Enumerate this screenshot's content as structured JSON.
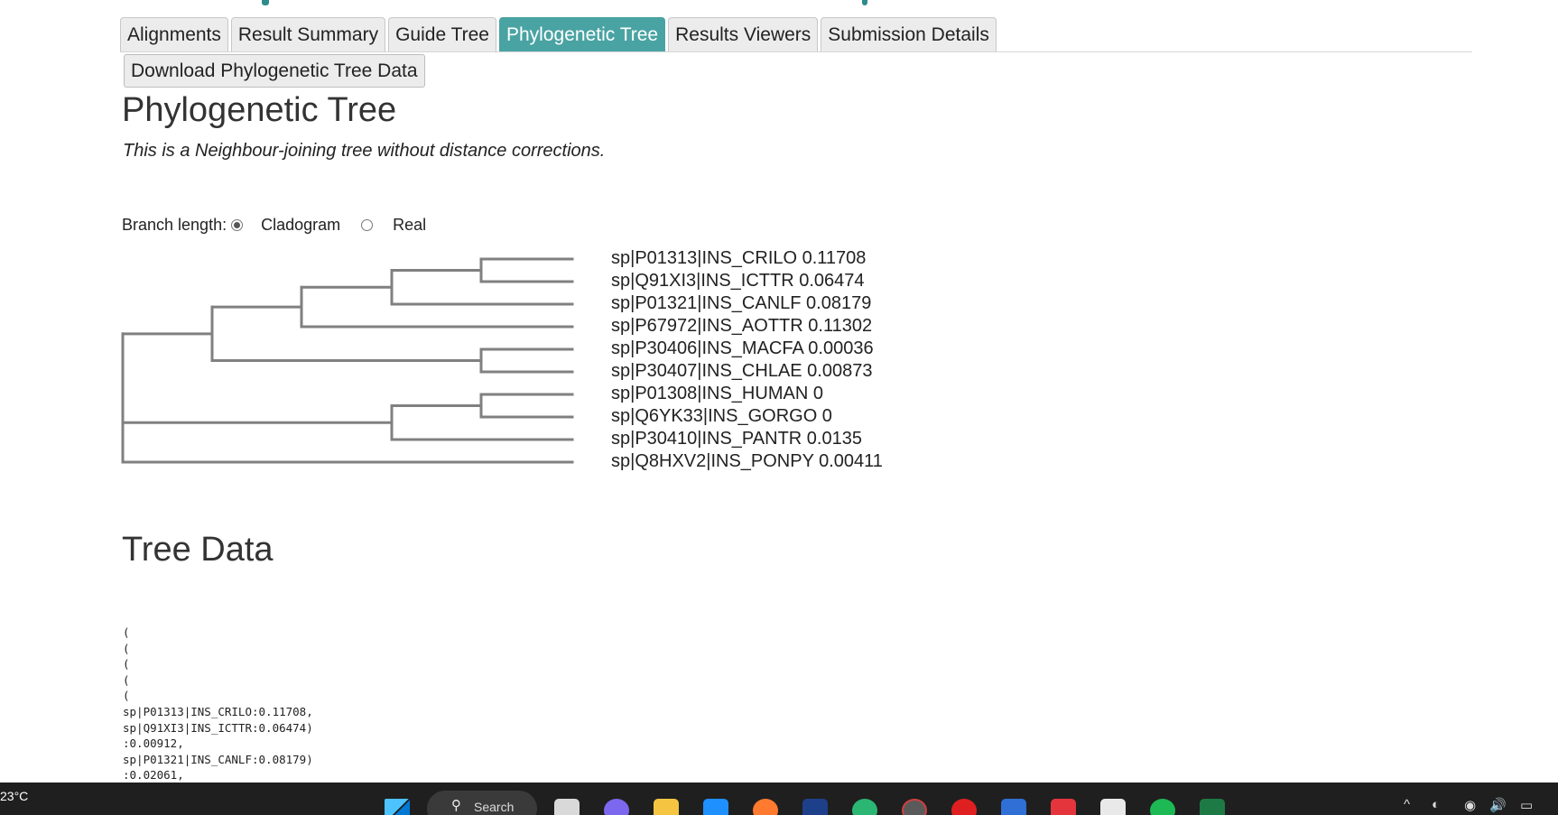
{
  "tabs": [
    {
      "label": "Alignments",
      "active": false
    },
    {
      "label": "Result Summary",
      "active": false
    },
    {
      "label": "Guide Tree",
      "active": false
    },
    {
      "label": "Phylogenetic Tree",
      "active": true
    },
    {
      "label": "Results Viewers",
      "active": false
    },
    {
      "label": "Submission Details",
      "active": false
    }
  ],
  "download_button": "Download Phylogenetic Tree Data",
  "title": "Phylogenetic Tree",
  "subtitle": "This is a Neighbour-joining tree without distance corrections.",
  "branch_length": {
    "label": "Branch length:",
    "options": [
      {
        "label": "Cladogram",
        "selected": true
      },
      {
        "label": "Real",
        "selected": false
      }
    ]
  },
  "tree": {
    "leaves": [
      "sp|P01313|INS_CRILO 0.11708",
      "sp|Q91XI3|INS_ICTTR 0.06474",
      "sp|P01321|INS_CANLF 0.08179",
      "sp|P67972|INS_AOTTR 0.11302",
      "sp|P30406|INS_MACFA 0.00036",
      "sp|P30407|INS_CHLAE 0.00873",
      "sp|P01308|INS_HUMAN 0",
      "sp|Q6YK33|INS_GORGO 0",
      "sp|P30410|INS_PANTR 0.0135",
      "sp|Q8HXV2|INS_PONPY 0.00411"
    ],
    "line_color": "#808080"
  },
  "tree_data_title": "Tree Data",
  "newick_lines": [
    "(",
    "(",
    "(",
    "(",
    "(",
    "sp|P01313|INS_CRILO:0.11708,",
    "sp|Q91XI3|INS_ICTTR:0.06474)",
    ":0.00912,",
    "sp|P01321|INS_CANLF:0.08179)",
    ":0.02061,"
  ],
  "taskbar": {
    "weather": "23°C",
    "search_label": "Search",
    "search_glyph": "⚲",
    "tray_icons": [
      "^",
      "◐",
      "◉",
      "🔊",
      "▭"
    ]
  },
  "colors": {
    "accent": "#4aa3a3",
    "taskbar_bg": "#1f1f1f"
  }
}
